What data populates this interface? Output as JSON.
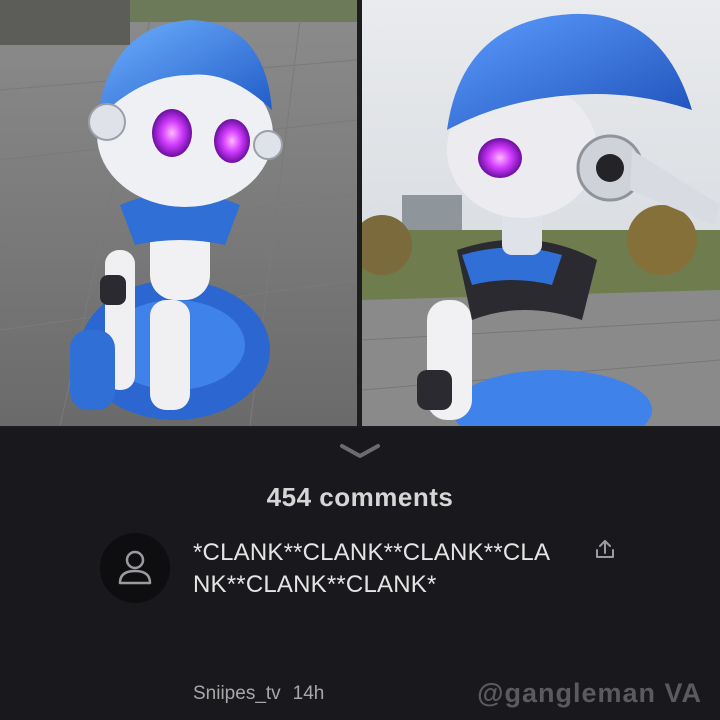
{
  "images": {
    "left_icon": "robot-front-photo",
    "right_icon": "robot-side-photo"
  },
  "sheet": {
    "handle_icon": "chevron-down-icon",
    "comments_count": "454 comments"
  },
  "comment": {
    "avatar_icon": "person-icon",
    "text": "*CLANK**CLANK**CLANK**CLANK**CLANK**CLANK*",
    "share_icon": "share-icon",
    "username": "Sniipes_tv",
    "time": "14h"
  },
  "watermark": "@gangleman VA",
  "colors": {
    "background": "#19191d",
    "text": "#e4e4e4",
    "muted": "#a7a7a7",
    "robot_blue": "#2f6fd6",
    "robot_eye": "#d23cff"
  }
}
